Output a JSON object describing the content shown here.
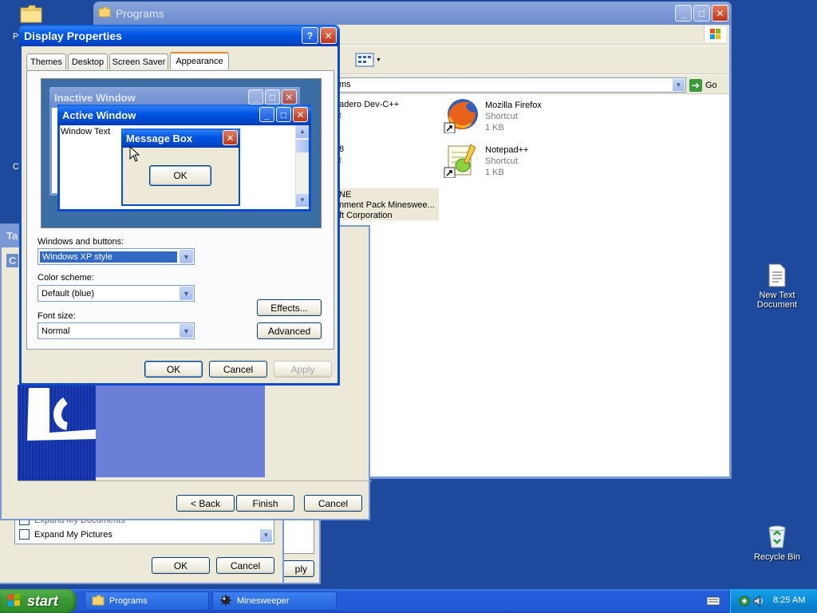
{
  "desktop": {
    "icons": [
      {
        "label": "New Text\nDocument",
        "icon": "text-document-icon"
      },
      {
        "label": "Recycle Bin",
        "icon": "recycle-bin-icon"
      }
    ],
    "partial_letters": {
      "p": "P",
      "c": "C"
    }
  },
  "programs_window": {
    "title": "Programs",
    "address_value": "ms",
    "go_label": "Go",
    "files": [
      {
        "name": "adero Dev-C++",
        "type": "t",
        "size": ""
      },
      {
        "name": "Mozilla Firefox",
        "type": "Shortcut",
        "size": "1 KB"
      },
      {
        "name": "8",
        "type": "t",
        "size": ""
      },
      {
        "name": "Notepad++",
        "type": "Shortcut",
        "size": "1 KB"
      },
      {
        "name": "NE",
        "type": "nment Pack Mineswee...",
        "size": "ft Corporation"
      }
    ]
  },
  "display_properties": {
    "title": "Display Properties",
    "tabs": [
      "Themes",
      "Desktop",
      "Screen Saver",
      "Appearance"
    ],
    "active_tab": "Appearance",
    "preview": {
      "inactive_title": "Inactive Window",
      "active_title": "Active Window",
      "window_text": "Window Text",
      "message_box_title": "Message Box",
      "ok_label": "OK"
    },
    "windows_buttons_label": "Windows and buttons:",
    "windows_buttons_value": "Windows XP style",
    "color_scheme_label": "Color scheme:",
    "color_scheme_value": "Default (blue)",
    "font_size_label": "Font size:",
    "font_size_value": "Normal",
    "effects_label": "Effects...",
    "advanced_label": "Advanced",
    "ok_label": "OK",
    "cancel_label": "Cancel",
    "apply_label": "Apply"
  },
  "wizard": {
    "partial_tab": "Ta",
    "partial_c": "C",
    "back_label": "< Back",
    "finish_label": "Finish",
    "cancel_label": "Cancel"
  },
  "taskbar_props": {
    "checkboxes": [
      "Expand My Documents",
      "Expand My Pictures"
    ],
    "ok_label": "OK",
    "cancel_label": "Cancel",
    "apply_partial": "ply"
  },
  "taskbar": {
    "start_label": "start",
    "tasks": [
      {
        "label": "Programs",
        "icon": "folder-icon"
      },
      {
        "label": "Minesweeper",
        "icon": "minesweeper-icon"
      }
    ],
    "clock": "8:25 AM"
  },
  "colors": {
    "desktop": "#1d4a9c",
    "title_active": "#0054e3",
    "dialog_face": "#ece9d8",
    "taskbar": "#245edb",
    "start": "#3c9a35"
  }
}
